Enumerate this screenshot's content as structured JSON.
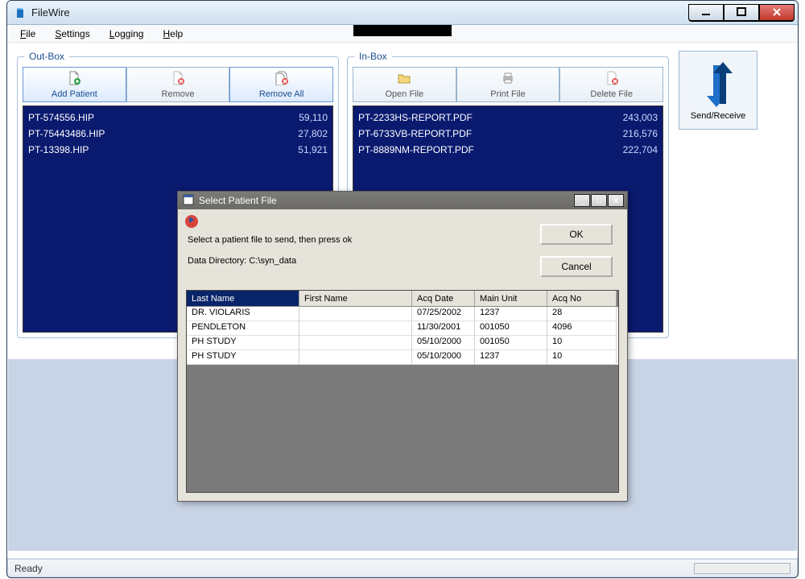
{
  "window": {
    "title": "FileWire",
    "status": "Ready"
  },
  "menu": [
    "File",
    "Settings",
    "Logging",
    "Help"
  ],
  "menu_underlines": [
    0,
    0,
    0,
    0
  ],
  "outbox": {
    "title": "Out-Box",
    "buttons": {
      "add": "Add Patient",
      "remove": "Remove",
      "remove_all": "Remove All"
    },
    "rows": [
      {
        "name": "PT-574556.HIP",
        "size": "59,110"
      },
      {
        "name": "PT-75443486.HIP",
        "size": "27,802"
      },
      {
        "name": "PT-13398.HIP",
        "size": "51,921"
      }
    ]
  },
  "inbox": {
    "title": "In-Box",
    "buttons": {
      "open": "Open File",
      "print": "Print File",
      "delete": "Delete File"
    },
    "rows": [
      {
        "name": "PT-2233HS-REPORT.PDF",
        "size": "243,003"
      },
      {
        "name": "PT-6733VB-REPORT.PDF",
        "size": "216,576"
      },
      {
        "name": "PT-8889NM-REPORT.PDF",
        "size": "222,704"
      }
    ]
  },
  "send_receive_label": "Send/Receive",
  "dialog": {
    "title": "Select Patient File",
    "prompt": "Select a patient file to send, then press ok",
    "datadir": "Data Directory: C:\\syn_data",
    "ok": "OK",
    "cancel": "Cancel",
    "columns": [
      "Last Name",
      "First Name",
      "Acq Date",
      "Main Unit",
      "Acq No"
    ],
    "rows": [
      {
        "ln": "DR. VIOLARIS",
        "fn": "",
        "ad": "07/25/2002",
        "mu": "1237",
        "an": "28"
      },
      {
        "ln": "PENDLETON",
        "fn": "",
        "ad": "11/30/2001",
        "mu": "001050",
        "an": "4096"
      },
      {
        "ln": "PH STUDY",
        "fn": "",
        "ad": "05/10/2000",
        "mu": "001050",
        "an": "10"
      },
      {
        "ln": "PH STUDY",
        "fn": "",
        "ad": "05/10/2000",
        "mu": "1237",
        "an": "10"
      }
    ]
  },
  "colors": {
    "listbox_bg": "#0a1a6f",
    "accent": "#1b4f8f"
  }
}
